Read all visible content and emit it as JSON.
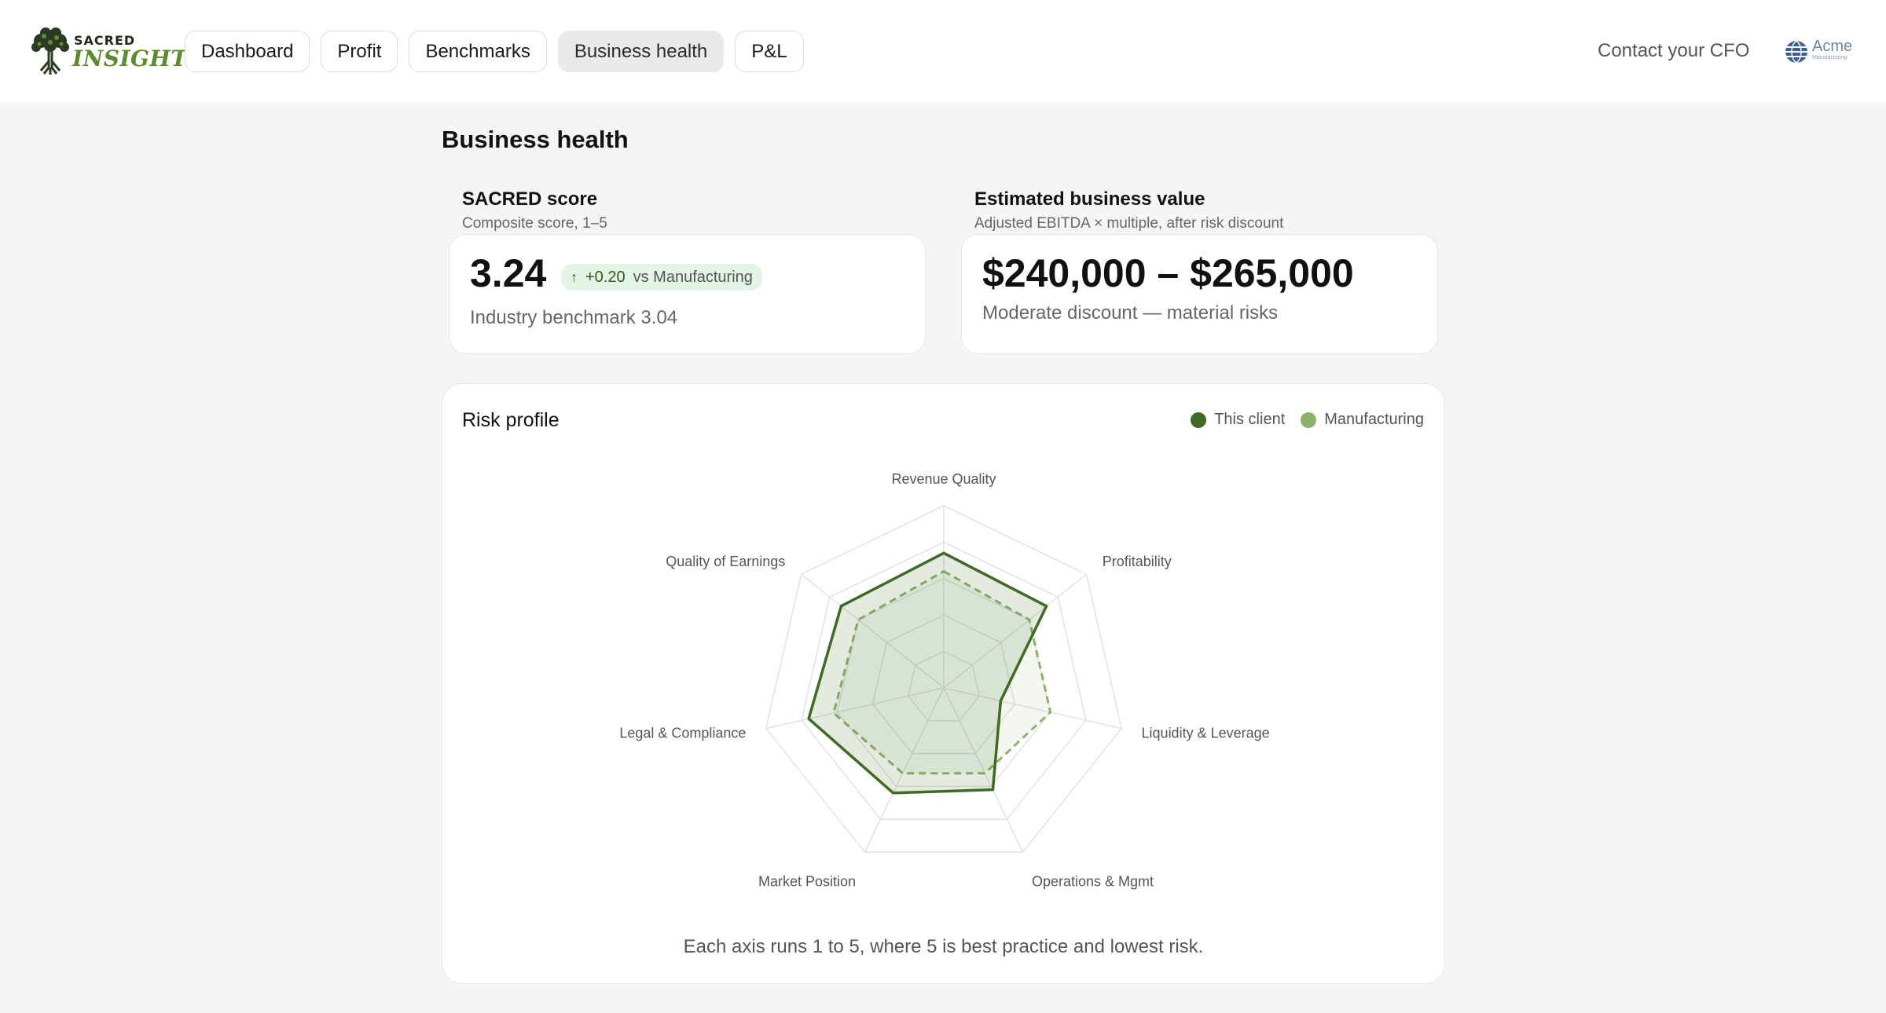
{
  "brand": {
    "word_top": "SACRED",
    "word_bottom": "INSIGHTS",
    "accent": "#5c8a2e"
  },
  "nav": {
    "items": [
      {
        "label": "Dashboard",
        "active": false
      },
      {
        "label": "Profit",
        "active": false
      },
      {
        "label": "Benchmarks",
        "active": false
      },
      {
        "label": "Business health",
        "active": true
      },
      {
        "label": "P&L",
        "active": false
      }
    ]
  },
  "header": {
    "contact_label": "Contact your CFO",
    "client_logo_text": "Acme",
    "client_logo_sub": "Manufacturing"
  },
  "page": {
    "title": "Business health"
  },
  "sacred_score": {
    "label": "SACRED score",
    "sublabel": "Composite score, 1–5",
    "value": "3.24",
    "delta_arrow": "↑",
    "delta": "+0.20",
    "delta_vs": "vs Manufacturing",
    "benchmark": "Industry benchmark 3.04"
  },
  "business_value": {
    "label": "Estimated business value",
    "sublabel": "Adjusted EBITDA × multiple, after risk discount",
    "range": "$240,000 – $265,000",
    "note": "Moderate discount — material risks"
  },
  "risk_profile": {
    "title": "Risk profile",
    "footnote": "Each axis runs 1 to 5, where 5 is best practice and lowest risk.",
    "legend": [
      {
        "label": "This client",
        "color": "#3f6a24"
      },
      {
        "label": "Manufacturing",
        "color": "#8db26c"
      }
    ]
  },
  "chart_data": {
    "type": "radar",
    "axes": [
      "Revenue Quality",
      "Profitability",
      "Liquidity & Leverage",
      "Operations & Mgmt",
      "Market Position",
      "Legal & Compliance",
      "Quality of Earnings"
    ],
    "range": [
      1,
      5
    ],
    "grid_levels": [
      1,
      2,
      3,
      4,
      5
    ],
    "series": [
      {
        "name": "This client",
        "values": [
          3.7,
          3.6,
          1.6,
          3.1,
          3.2,
          3.8,
          3.6
        ],
        "color": "#3f6a24",
        "style": "solid"
      },
      {
        "name": "Manufacturing",
        "values": [
          3.2,
          3.0,
          3.0,
          2.6,
          2.6,
          3.1,
          3.0
        ],
        "color": "#8db26c",
        "style": "dashed"
      }
    ]
  }
}
